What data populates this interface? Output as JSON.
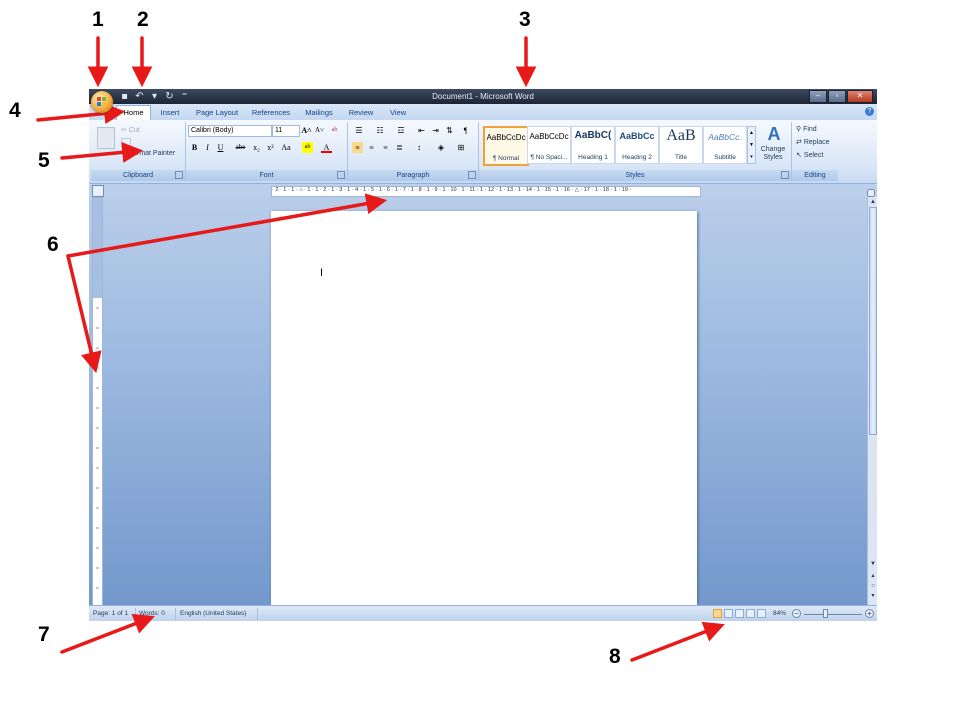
{
  "callouts": [
    "1",
    "2",
    "3",
    "4",
    "5",
    "6",
    "7",
    "8"
  ],
  "window": {
    "title": "Document1 - Microsoft Word"
  },
  "tabs": [
    "Home",
    "Insert",
    "Page Layout",
    "References",
    "Mailings",
    "Review",
    "View"
  ],
  "clipboard": {
    "cut": "Cut",
    "format_painter": "Format Painter",
    "label": "Clipboard"
  },
  "font": {
    "name": "Calibri (Body)",
    "size": "11",
    "label": "Font",
    "bold": "B",
    "italic": "I",
    "underline": "U",
    "strike": "abe",
    "subscript": "x₂",
    "superscript": "x²",
    "change_case": "Aa"
  },
  "paragraph": {
    "label": "Paragraph"
  },
  "styles": {
    "label": "Styles",
    "items": [
      {
        "preview": "AaBbCcDc",
        "name": "¶ Normal"
      },
      {
        "preview": "AaBbCcDc",
        "name": "¶ No Spaci..."
      },
      {
        "preview": "AaBbC(",
        "name": "Heading 1"
      },
      {
        "preview": "AaBbCc",
        "name": "Heading 2"
      },
      {
        "preview": "AaB",
        "name": "Title"
      },
      {
        "preview": "AaBbCc.",
        "name": "Subtitle"
      }
    ],
    "change_styles": "Change Styles"
  },
  "editing": {
    "find": "Find",
    "replace": "Replace",
    "select": "Select",
    "label": "Editing"
  },
  "ruler": {
    "horizontal": "· 2 · 1 · 1 · ⌂ · 1 · 1 · 2 · 1 · 3 · 1 · 4 · 1 · 5 · 1 · 6 · 1 · 7 · 1 · 8 · 1 · 9 · 1 · 10 · 1 · 11 · 1 · 12 · 1 · 13 · 1 · 14 · 1 · 15 · 1 · 16 · △ · 17 · 1 · 18 · 1 · 19 ·"
  },
  "document": {
    "cursor": "I"
  },
  "status": {
    "page": "Page: 1 of 1",
    "words": "Words: 0",
    "language": "English (United States)",
    "zoom": "84%"
  },
  "colors": {
    "arrow": "#e81919",
    "accent": "#15428b"
  }
}
